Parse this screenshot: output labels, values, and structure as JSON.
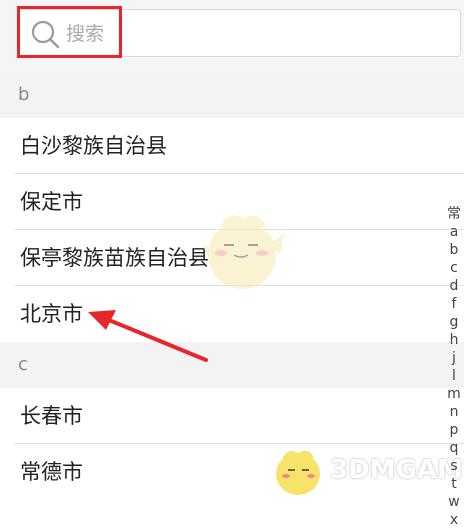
{
  "search": {
    "placeholder": "搜索"
  },
  "sections": [
    {
      "header": "b",
      "items": [
        "白沙黎族自治县",
        "保定市",
        "保亭黎族苗族自治县",
        "北京市"
      ]
    },
    {
      "header": "c",
      "items": [
        "长春市",
        "常德市"
      ]
    }
  ],
  "index_bar": [
    "常",
    "a",
    "b",
    "c",
    "d",
    "f",
    "g",
    "h",
    "j",
    "l",
    "m",
    "n",
    "p",
    "q",
    "s",
    "t",
    "w",
    "x"
  ],
  "watermark": "3DMGAME",
  "colors": {
    "highlight": "#e8252b",
    "section_bg": "#f3f3f5",
    "divider": "#e1e1e4"
  }
}
